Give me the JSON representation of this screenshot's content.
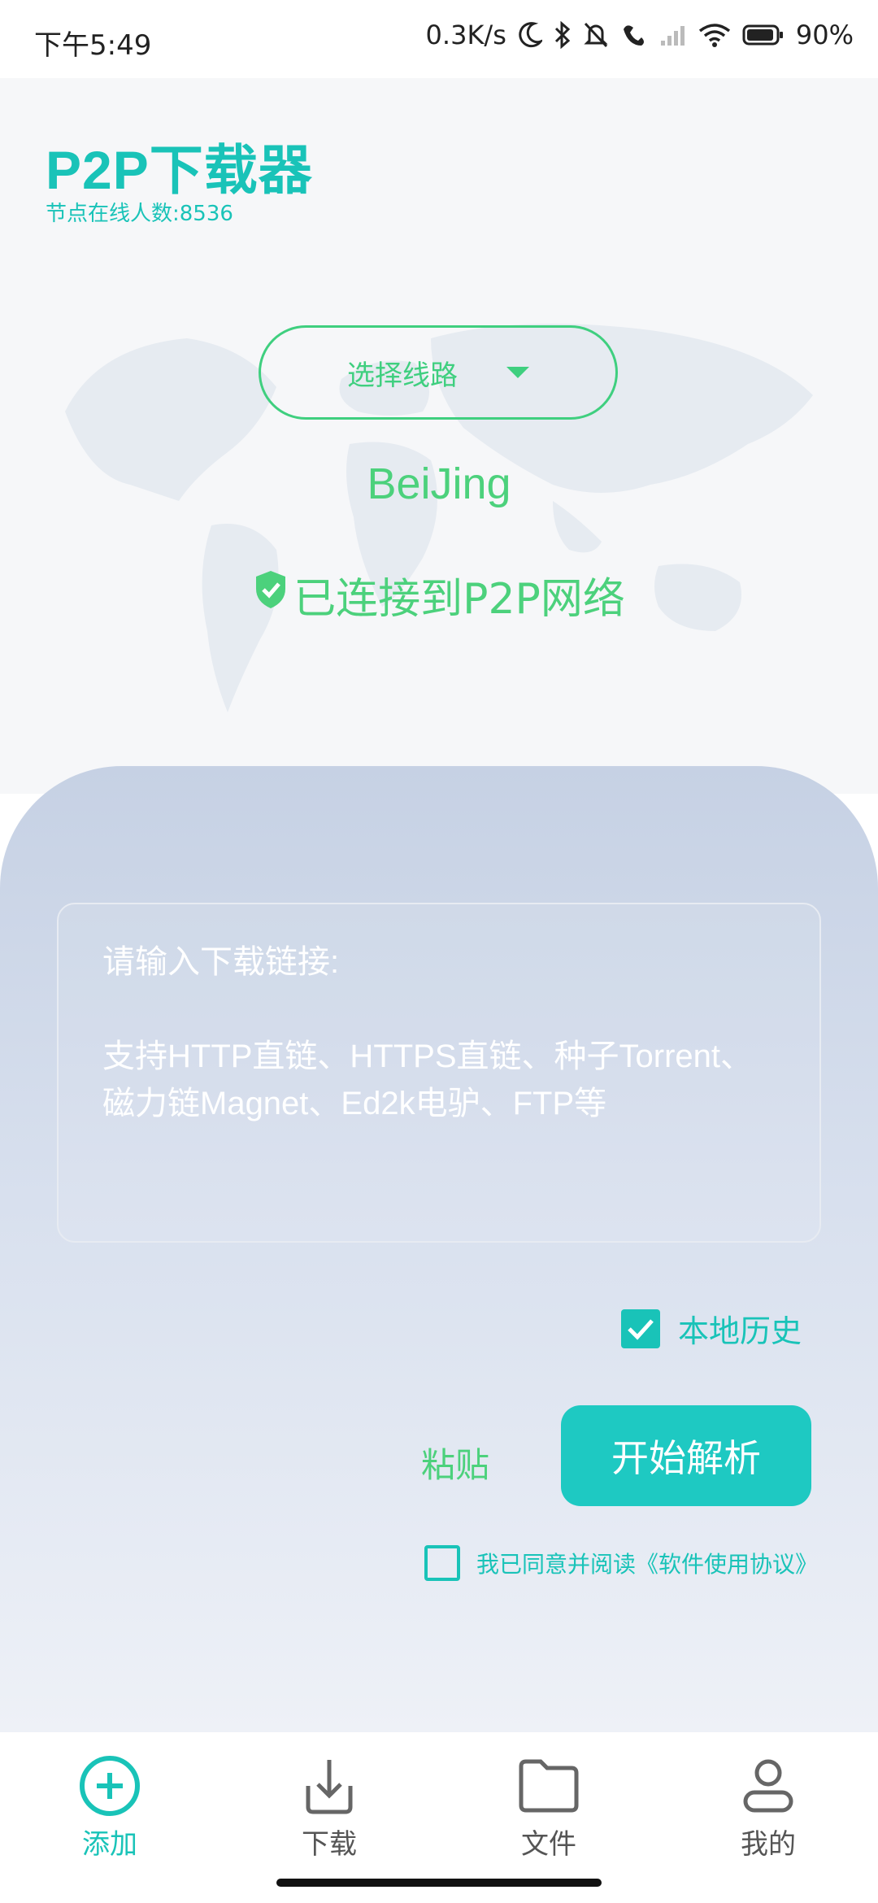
{
  "status_bar": {
    "time": "下午5:49",
    "net_speed": "0.3K/s",
    "battery": "90%"
  },
  "header": {
    "app_title": "P2P下载器",
    "node_count": "节点在线人数:8536"
  },
  "route": {
    "select_label": "选择线路",
    "city": "BeiJing",
    "connection_status": "已连接到P2P网络"
  },
  "input": {
    "placeholder_line1": "请输入下载链接:",
    "placeholder_line2": " 支持HTTP直链、HTTPS直链、种子Torrent、磁力链Magnet、Ed2k电驴、FTP等"
  },
  "options": {
    "local_history_label": "本地历史",
    "local_history_checked": true,
    "agree_label": "我已同意并阅读《软件使用协议》",
    "agree_checked": false
  },
  "actions": {
    "paste_label": "粘贴",
    "parse_label": "开始解析"
  },
  "bottom_nav": {
    "items": [
      {
        "label": "添加",
        "icon": "plus-circle-icon",
        "active": true
      },
      {
        "label": "下载",
        "icon": "download-icon",
        "active": false
      },
      {
        "label": "文件",
        "icon": "folder-icon",
        "active": false
      },
      {
        "label": "我的",
        "icon": "user-icon",
        "active": false
      }
    ]
  },
  "colors": {
    "accent": "#19c3b8",
    "green": "#4cd17c",
    "button": "#1ec9c2"
  }
}
